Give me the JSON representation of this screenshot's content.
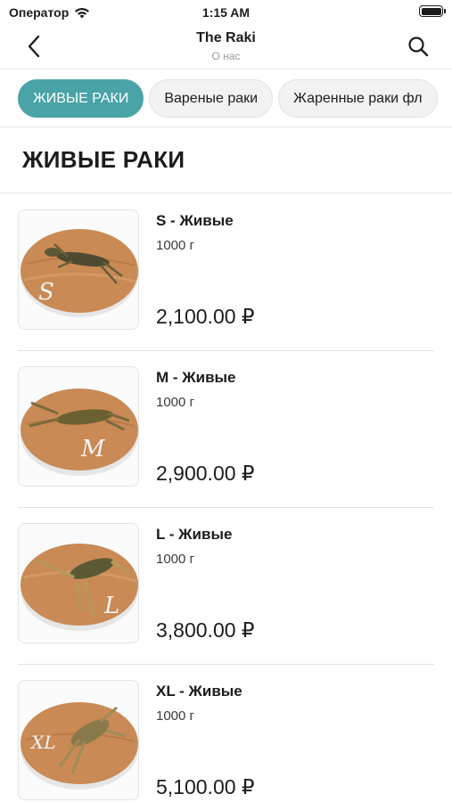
{
  "status_bar": {
    "carrier": "Оператор",
    "time": "1:15 AM"
  },
  "nav": {
    "title": "The Raki",
    "subtitle": "О нас",
    "back_icon": "chevron-left-icon",
    "search_icon": "search-icon"
  },
  "tabs": [
    {
      "label": "ЖИВЫЕ РАКИ",
      "active": true
    },
    {
      "label": "Вареные раки",
      "active": false
    },
    {
      "label": "Жаренные раки фл",
      "active": false
    }
  ],
  "section": {
    "title": "ЖИВЫЕ РАКИ"
  },
  "products": [
    {
      "name": "S - Живые",
      "weight": "1000 г",
      "price": "2,100.00 ₽",
      "letter": "S"
    },
    {
      "name": "M - Живые",
      "weight": "1000 г",
      "price": "2,900.00 ₽",
      "letter": "M"
    },
    {
      "name": "L - Живые",
      "weight": "1000 г",
      "price": "3,800.00 ₽",
      "letter": "L"
    },
    {
      "name": "XL - Живые",
      "weight": "1000 г",
      "price": "5,100.00 ₽",
      "letter": "XL"
    }
  ],
  "colors": {
    "accent": "#4aa3a6",
    "board_wood": "#c98a55",
    "crayfish": "#5a5a3a"
  }
}
